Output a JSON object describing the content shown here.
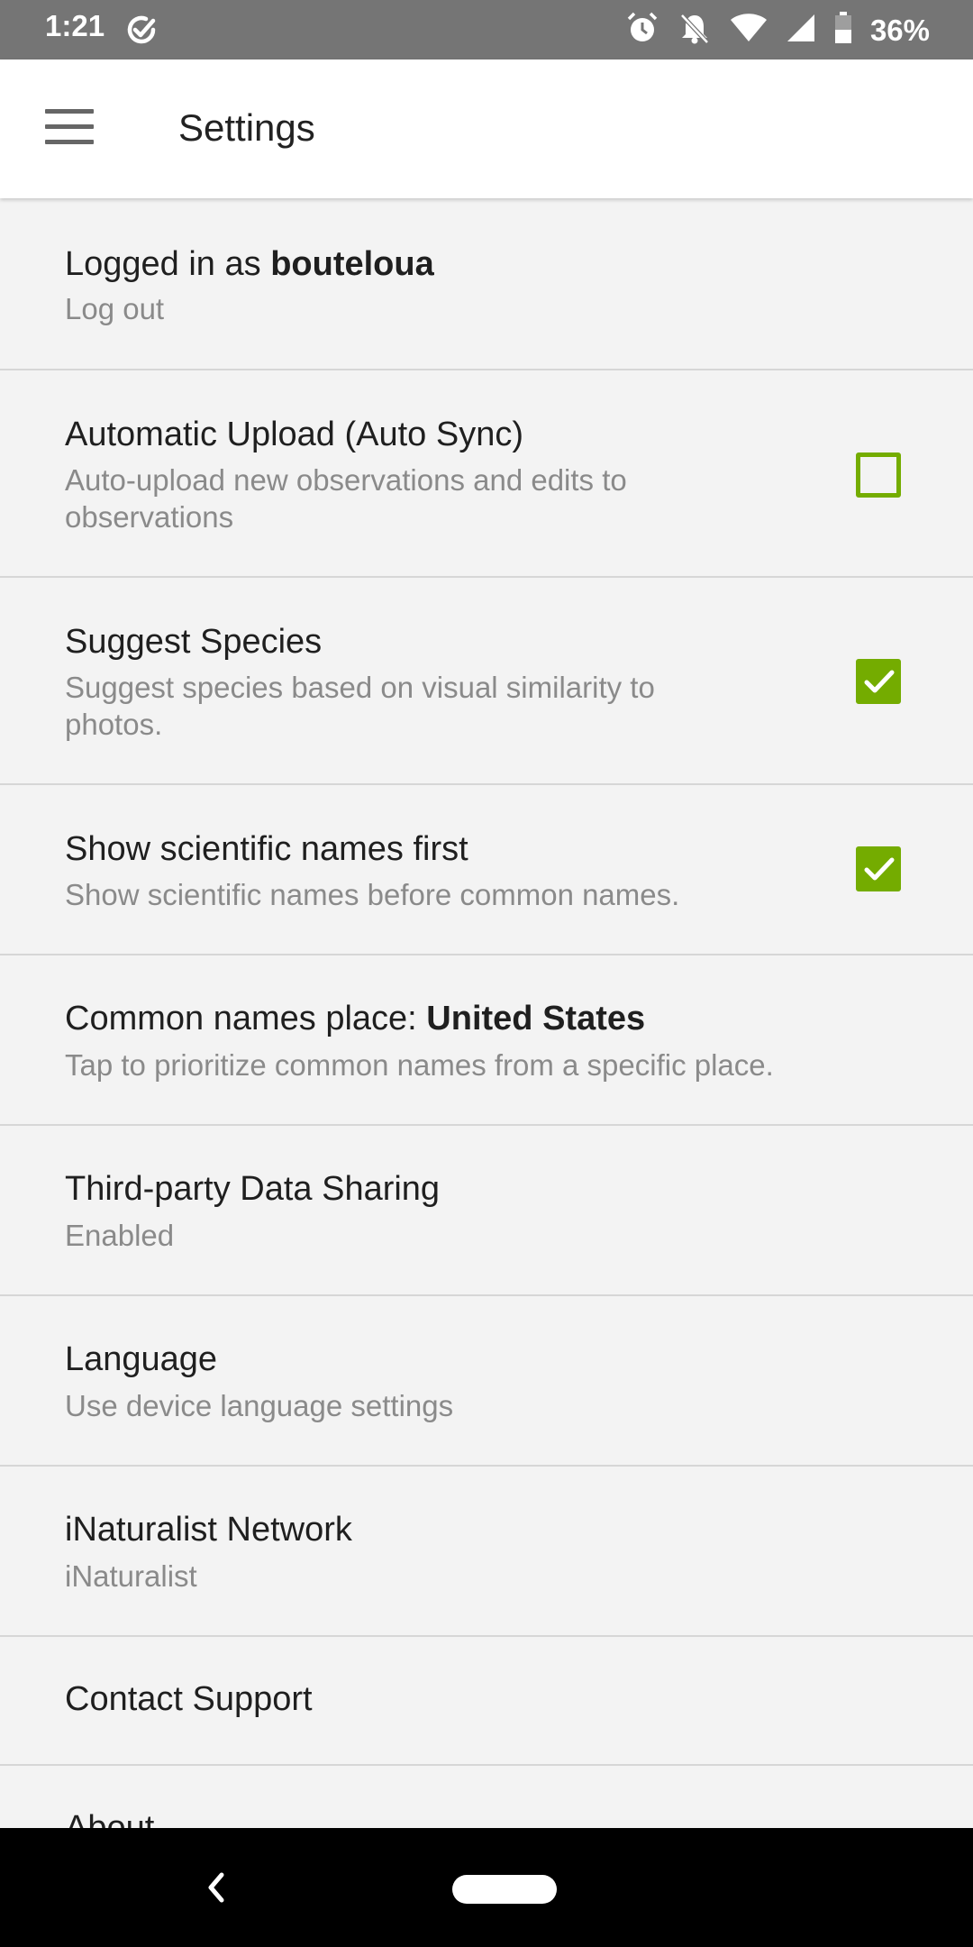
{
  "status_bar": {
    "time": "1:21",
    "battery": "36%",
    "icons": [
      "check-circle-icon",
      "alarm-icon",
      "bell-off-icon",
      "wifi-icon",
      "signal-icon",
      "battery-icon"
    ]
  },
  "app_bar": {
    "title": "Settings",
    "menu_icon": "hamburger-icon"
  },
  "settings": {
    "login": {
      "prefix": "Logged in as ",
      "username": "bouteloua",
      "action": "Log out"
    },
    "auto_upload": {
      "title": "Automatic Upload (Auto Sync)",
      "description_line1": "Auto-upload new observations and edits to",
      "description_line2": "observations",
      "checked": false
    },
    "suggest_species": {
      "title": "Suggest Species",
      "description_line1": "Suggest species based on visual similarity to",
      "description_line2": "photos.",
      "checked": true
    },
    "scientific_names": {
      "title": "Show scientific names first",
      "description": "Show scientific names before common names.",
      "checked": true
    },
    "common_names_place": {
      "prefix": "Common names place: ",
      "value": "United States",
      "description": "Tap to prioritize common names from a specific place."
    },
    "data_sharing": {
      "title": "Third-party Data Sharing",
      "value": "Enabled"
    },
    "language": {
      "title": "Language",
      "value": "Use device language settings"
    },
    "network": {
      "title": "iNaturalist Network",
      "value": "iNaturalist"
    },
    "contact": {
      "title": "Contact Support"
    },
    "about": {
      "title": "About"
    }
  },
  "colors": {
    "accent": "#74ac00",
    "status_bar": "#757575",
    "background": "#f3f3f3",
    "nav_bar": "#000000"
  }
}
